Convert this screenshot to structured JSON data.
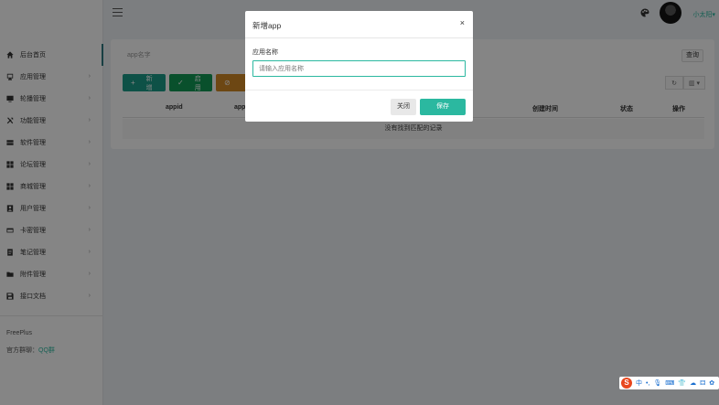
{
  "sidebar": {
    "items": [
      {
        "label": "后台首页",
        "icon": "home-icon",
        "has_arrow": false
      },
      {
        "label": "应用管理",
        "icon": "desktop-icon",
        "has_arrow": true
      },
      {
        "label": "轮播管理",
        "icon": "monitor-icon",
        "has_arrow": true
      },
      {
        "label": "功能管理",
        "icon": "tools-icon",
        "has_arrow": true
      },
      {
        "label": "软件管理",
        "icon": "server-icon",
        "has_arrow": true
      },
      {
        "label": "论坛管理",
        "icon": "grid-icon",
        "has_arrow": true
      },
      {
        "label": "商城管理",
        "icon": "grid-icon",
        "has_arrow": true
      },
      {
        "label": "用户管理",
        "icon": "user-icon",
        "has_arrow": true
      },
      {
        "label": "卡密管理",
        "icon": "card-icon",
        "has_arrow": true
      },
      {
        "label": "笔记管理",
        "icon": "note-icon",
        "has_arrow": true
      },
      {
        "label": "附件管理",
        "icon": "folder-icon",
        "has_arrow": true
      },
      {
        "label": "接口文档",
        "icon": "save-icon",
        "has_arrow": true
      }
    ],
    "arrow": "›",
    "footer": {
      "brand": "FreePlus",
      "group_label": "官方群聊：",
      "group_link": "QQ群"
    }
  },
  "topbar": {
    "username": "小太阳",
    "username_caret": "▾"
  },
  "search": {
    "placeholder": "app名字",
    "query_label": "查询"
  },
  "toolbar": {
    "add_label": "新增",
    "add_icon": "+",
    "enable_label": "启用",
    "enable_icon": "✓",
    "disable_icon": "⊘",
    "refresh_icon": "↻",
    "columns_icon": "▥ ▾"
  },
  "table": {
    "headers": [
      "appid",
      "app",
      "",
      "创建时间",
      "状态",
      "操作"
    ],
    "empty_text": "没有找到匹配的记录"
  },
  "modal": {
    "title": "新增app",
    "close_symbol": "×",
    "field_label": "应用名称",
    "field_placeholder": "请输入应用名称",
    "field_value": "",
    "cancel_label": "关闭",
    "save_label": "保存"
  },
  "ime": {
    "logo": "S",
    "items": [
      "中",
      "•,",
      "🎙",
      "⌨",
      "👕",
      "☁",
      "⚃",
      "✿"
    ]
  },
  "colors": {
    "accent": "#2bb8a0",
    "add_button": "#1b9c89",
    "enable_button": "#129a55",
    "disable_button": "#d28825"
  }
}
